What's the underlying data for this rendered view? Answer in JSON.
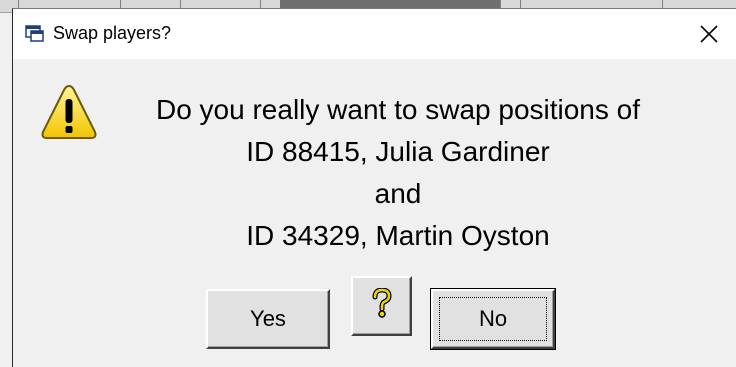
{
  "dialog": {
    "title": "Swap players?",
    "message_lines": [
      "Do you really want to swap positions of",
      "ID 88415, Julia Gardiner",
      "and",
      "ID 34329, Martin Oyston"
    ],
    "buttons": {
      "yes_label": "Yes",
      "no_label": "No"
    },
    "icons": {
      "title": "window-app-icon",
      "warning": "warning-icon",
      "help": "help-question-icon",
      "close": "close-icon"
    }
  },
  "colors": {
    "dialog_bg": "#f0f0f0",
    "titlebar_bg": "#ffffff",
    "warning_yellow": "#f8d825",
    "help_yellow": "#e8c800"
  }
}
